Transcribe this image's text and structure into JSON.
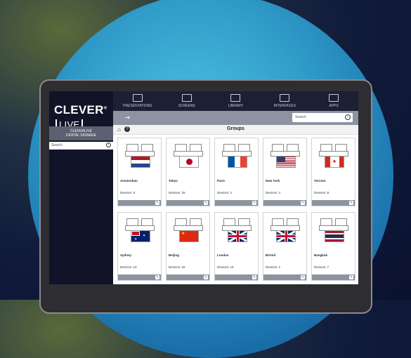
{
  "brand": {
    "logo_text": "CLEVER",
    "logo_reg": "®",
    "logo_live": "LIVE"
  },
  "sidebar": {
    "title_line1": "CLEVERLIVE",
    "title_line2": "DIGITAL SIGNAGE",
    "search_placeholder": "Search"
  },
  "nav": [
    {
      "label": "PRESENTATIONS",
      "icon": "presentation-icon"
    },
    {
      "label": "SCREENS",
      "icon": "monitor-icon"
    },
    {
      "label": "LIBRARY",
      "icon": "library-icon"
    },
    {
      "label": "INTERFACES",
      "icon": "users-icon"
    },
    {
      "label": "APPS",
      "icon": "android-icon"
    }
  ],
  "toolbar": {
    "search_placeholder": "Search"
  },
  "content": {
    "title": "Groups"
  },
  "groups": [
    {
      "name": "Amsterdam",
      "devices": "Devices: 5",
      "flag": "nl"
    },
    {
      "name": "Tokyo",
      "devices": "Devices: 25",
      "flag": "jp"
    },
    {
      "name": "Paris",
      "devices": "Devices: 2",
      "flag": "fr"
    },
    {
      "name": "New York",
      "devices": "Devices: 4",
      "flag": "us"
    },
    {
      "name": "Toronto",
      "devices": "Devices: 8",
      "flag": "ca"
    },
    {
      "name": "Sydney",
      "devices": "Devices: 10",
      "flag": "au"
    },
    {
      "name": "Beijing",
      "devices": "Devices: 32",
      "flag": "cn"
    },
    {
      "name": "London",
      "devices": "Devices: 15",
      "flag": "uk"
    },
    {
      "name": "Bristol",
      "devices": "Devices: 2",
      "flag": "uk"
    },
    {
      "name": "Bangkok",
      "devices": "Devices: 7",
      "flag": "th"
    }
  ]
}
